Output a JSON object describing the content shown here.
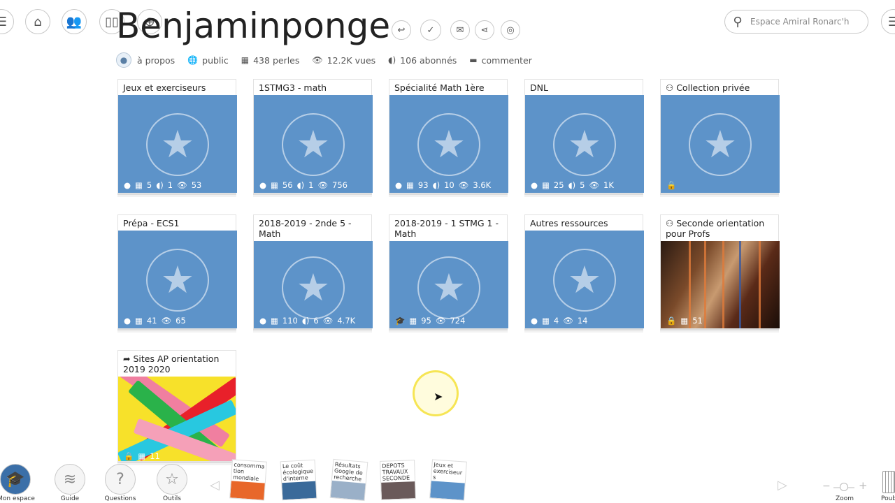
{
  "header": {
    "title": "Benjaminponge",
    "search_placeholder": "Espace Amiral Ronarc'h"
  },
  "stats": {
    "apropos": "à propos",
    "public": "public",
    "perles": "438 perles",
    "vues": "12.2K vues",
    "abonnes": "106 abonnés",
    "commenter": "commenter"
  },
  "cards": [
    {
      "title": "Jeux et exerciseurs",
      "m1": "5",
      "m2": "1",
      "m3": "53"
    },
    {
      "title": "1STMG3 - math",
      "m1": "56",
      "m2": "1",
      "m3": "756"
    },
    {
      "title": "Spécialité Math 1ère",
      "m1": "93",
      "m2": "10",
      "m3": "3.6K"
    },
    {
      "title": "DNL",
      "m1": "25",
      "m2": "5",
      "m3": "1K"
    },
    {
      "title": "Collection privée"
    },
    {
      "title": "Prépa - ECS1",
      "m1": "41",
      "m3": "65"
    },
    {
      "title": "2018-2019 - 2nde 5 - Math",
      "m1": "110",
      "m2": "6",
      "m3": "4.7K"
    },
    {
      "title": "2018-2019 - 1 STMG 1 - Math",
      "m1": "95",
      "m3": "724"
    },
    {
      "title": "Autres ressources",
      "m1": "4",
      "m3": "14"
    },
    {
      "title": "Seconde orientation pour Profs",
      "m1": "51"
    },
    {
      "title": "Sites AP orientation 2019 2020",
      "m1": "11"
    }
  ],
  "bottom": {
    "mon_espace": "Mon espace",
    "guide": "Guide",
    "questions": "Questions",
    "outils": "Outils",
    "zoom": "Zoom",
    "poubelle": "Poub",
    "minis": [
      "consomma tion mondiale",
      "Le coût écologique d'interne",
      "Résultats Google de recherche",
      "DEPOTS TRAVAUX SECONDE",
      "Jeux et exerciseur s"
    ]
  },
  "colors": {
    "tile_blue": "#5d93c9",
    "accent_yellow": "#f5e13c"
  }
}
